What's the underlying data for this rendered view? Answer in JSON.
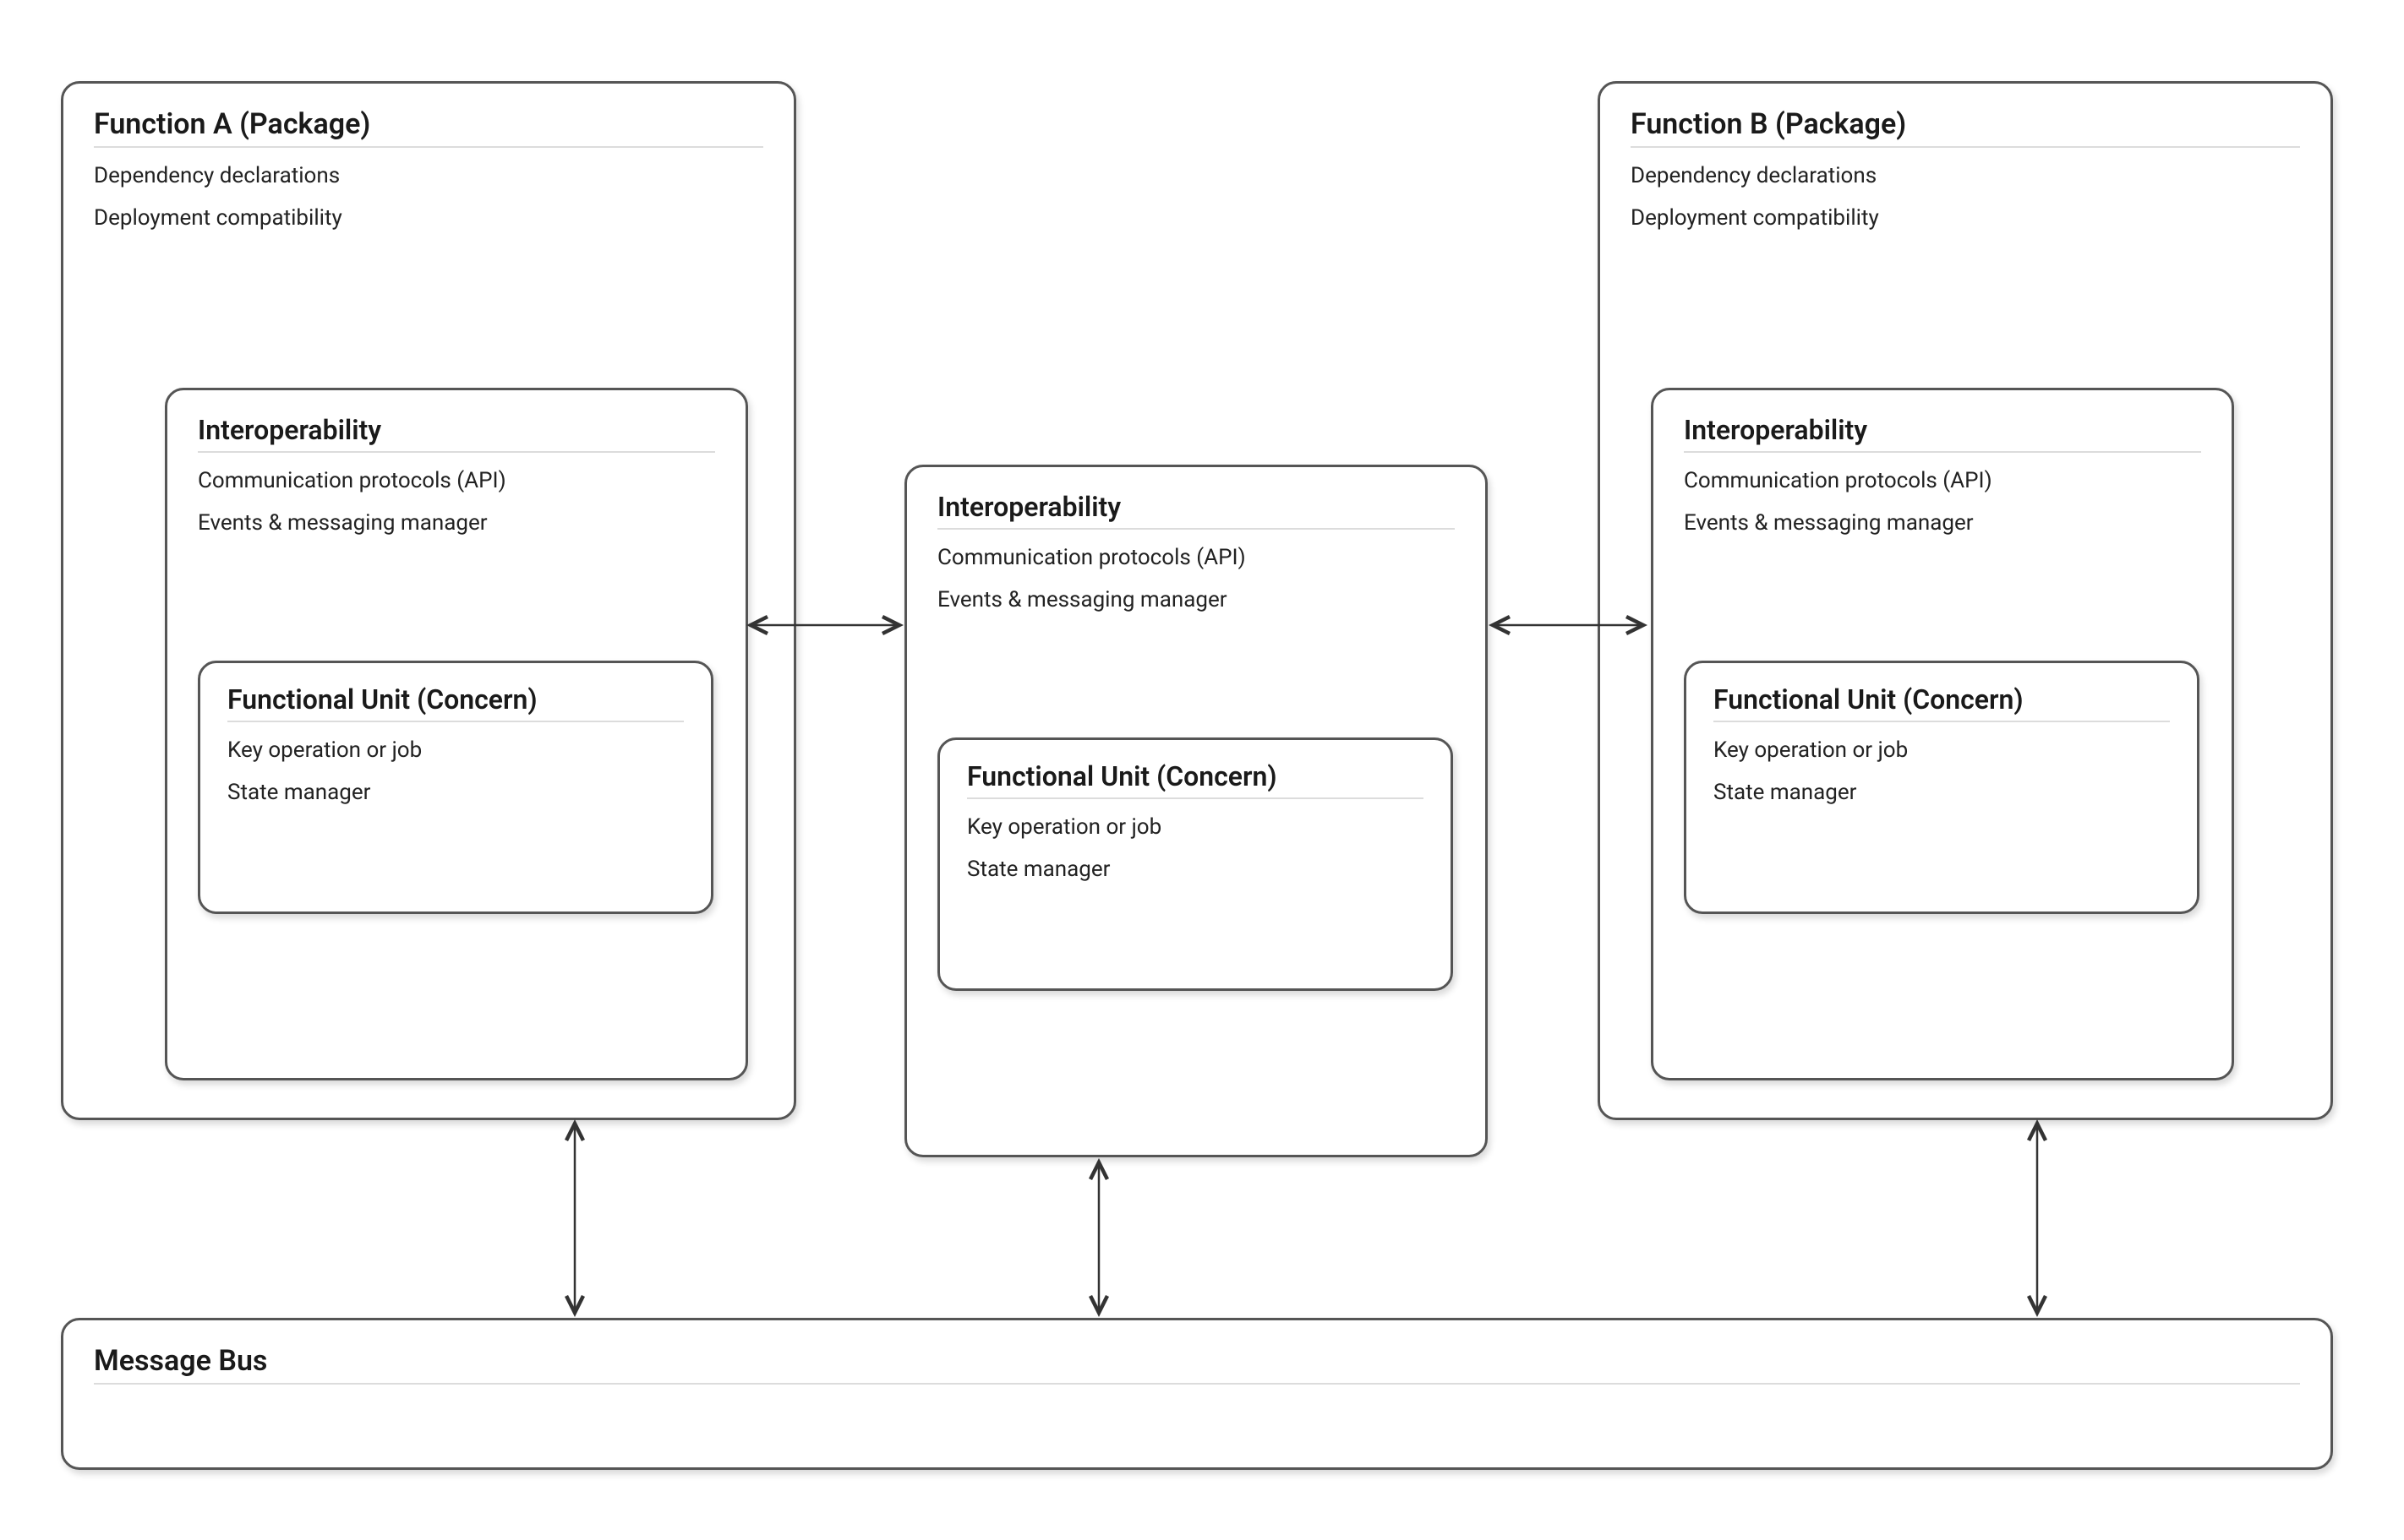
{
  "functionA": {
    "title": "Function A (Package)",
    "items": [
      "Dependency declarations",
      "Deployment compatibility"
    ],
    "interop": {
      "title": "Interoperability",
      "items": [
        "Communication protocols (API)",
        "Events & messaging manager"
      ],
      "unit": {
        "title": "Functional Unit (Concern)",
        "items": [
          "Key operation or job",
          "State manager"
        ]
      }
    }
  },
  "interopMiddle": {
    "title": "Interoperability",
    "items": [
      "Communication protocols (API)",
      "Events & messaging manager"
    ],
    "unit": {
      "title": "Functional Unit (Concern)",
      "items": [
        "Key operation or job",
        "State manager"
      ]
    }
  },
  "functionB": {
    "title": "Function B (Package)",
    "items": [
      "Dependency declarations",
      "Deployment compatibility"
    ],
    "interop": {
      "title": "Interoperability",
      "items": [
        "Communication protocols (API)",
        "Events & messaging manager"
      ],
      "unit": {
        "title": "Functional Unit (Concern)",
        "items": [
          "Key operation or job",
          "State manager"
        ]
      }
    }
  },
  "messageBus": {
    "title": "Message Bus"
  }
}
